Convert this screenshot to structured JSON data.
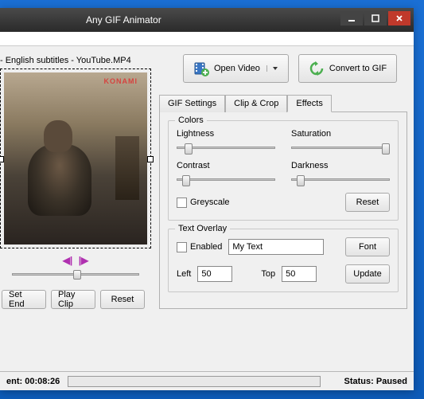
{
  "window": {
    "title": "Any GIF Animator"
  },
  "file": {
    "label": "- English subtitles - YouTube.MP4"
  },
  "watermark": "KONAMI",
  "clip_buttons": {
    "set_end": "Set End",
    "play_clip": "Play Clip",
    "reset": "Reset"
  },
  "main_buttons": {
    "open_video": "Open Video",
    "convert": "Convert to GIF"
  },
  "tabs": {
    "settings": "GIF Settings",
    "clip": "Clip & Crop",
    "effects": "Effects"
  },
  "colors": {
    "group": "Colors",
    "lightness": "Lightness",
    "saturation": "Saturation",
    "contrast": "Contrast",
    "darkness": "Darkness",
    "greyscale": "Greyscale",
    "reset": "Reset",
    "positions": {
      "lightness": 8,
      "saturation": 92,
      "contrast": 6,
      "darkness": 6
    }
  },
  "overlay": {
    "group": "Text Overlay",
    "enabled": "Enabled",
    "text_value": "My Text",
    "font": "Font",
    "left_label": "Left",
    "left_value": "50",
    "top_label": "Top",
    "top_value": "50",
    "update": "Update"
  },
  "status": {
    "time_prefix": "ent:",
    "time_value": "00:08:26",
    "status_label": "Status:",
    "status_value": "Paused"
  }
}
